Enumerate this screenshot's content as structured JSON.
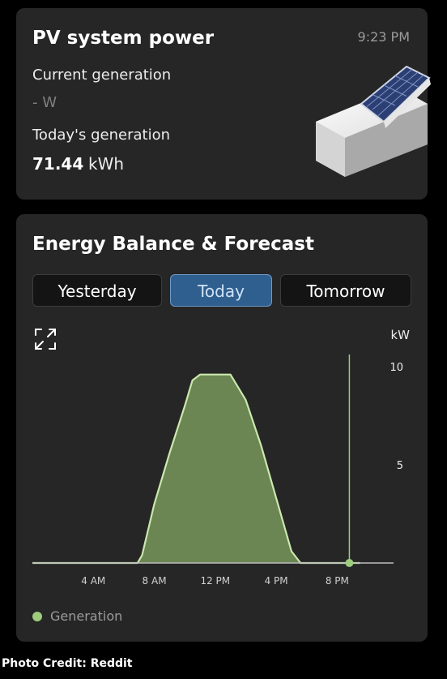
{
  "pv": {
    "title": "PV system power",
    "time": "9:23 PM",
    "current_label": "Current generation",
    "current_value": "- W",
    "today_label": "Today's generation",
    "today_value": "71.44",
    "today_unit": "kWh"
  },
  "energy": {
    "title": "Energy Balance & Forecast",
    "tabs": [
      "Yesterday",
      "Today",
      "Tomorrow"
    ],
    "active_tab": "Today",
    "legend": "Generation"
  },
  "colors": {
    "generation_fill": "#6b8553",
    "generation_line": "#cbe8ad",
    "marker": "#9ccc7c",
    "active_tab": "#2f5f8f"
  },
  "icons": {
    "expand": "expand-icon",
    "solar_panel": "solar-panel-illustration"
  },
  "chart_data": {
    "type": "area",
    "ylabel": "kW",
    "ylim": [
      0,
      10
    ],
    "y_ticks": [
      10,
      5
    ],
    "x_ticks": [
      "4 AM",
      "8 AM",
      "12 PM",
      "4 PM",
      "8 PM"
    ],
    "series": [
      {
        "name": "Generation",
        "x": [
          0,
          5,
          6.9,
          7.2,
          8,
          9,
          10,
          10.5,
          11,
          12,
          13,
          14,
          15,
          16,
          17,
          17.6,
          18,
          21.5
        ],
        "values": [
          0,
          0,
          0,
          0.4,
          3.0,
          5.6,
          8.0,
          9.3,
          9.6,
          9.6,
          9.6,
          8.3,
          6.0,
          3.3,
          0.6,
          0,
          0,
          0
        ]
      }
    ],
    "current_time_hour": 20.8,
    "xlim": [
      0,
      23.7
    ]
  },
  "credit": "Photo Credit: Reddit"
}
